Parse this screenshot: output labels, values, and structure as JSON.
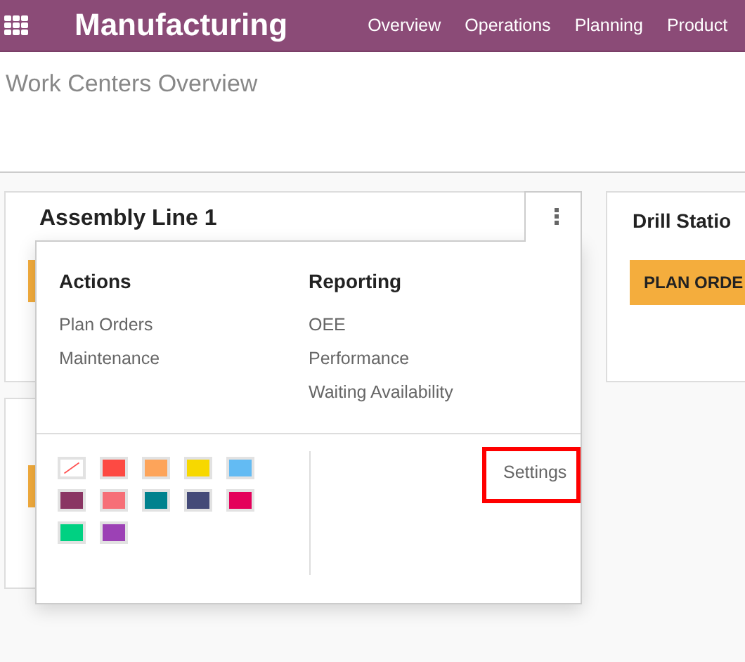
{
  "navbar": {
    "app_title": "Manufacturing",
    "menu": [
      {
        "label": "Overview"
      },
      {
        "label": "Operations"
      },
      {
        "label": "Planning"
      },
      {
        "label": "Product"
      }
    ]
  },
  "control_panel": {
    "title": "Work Centers Overview"
  },
  "cards": [
    {
      "title": "Assembly Line 1",
      "dropdown_open": true
    },
    {
      "title": "Drill Statio",
      "button": "PLAN ORDE",
      "dropdown_open": false
    }
  ],
  "dropdown": {
    "sections": [
      {
        "heading": "Actions",
        "items": [
          "Plan Orders",
          "Maintenance"
        ]
      },
      {
        "heading": "Reporting",
        "items": [
          "OEE",
          "Performance",
          "Waiting Availability"
        ]
      }
    ],
    "colors": [
      {
        "kind": "none",
        "color": "#ffffff"
      },
      {
        "kind": "swatch",
        "color": "#fd4a43"
      },
      {
        "kind": "swatch",
        "color": "#fda45a"
      },
      {
        "kind": "swatch",
        "color": "#f7d800"
      },
      {
        "kind": "swatch",
        "color": "#63bbf3"
      },
      {
        "kind": "swatch",
        "color": "#8a3563"
      },
      {
        "kind": "swatch",
        "color": "#f66f77"
      },
      {
        "kind": "swatch",
        "color": "#00828e"
      },
      {
        "kind": "swatch",
        "color": "#444a78"
      },
      {
        "kind": "swatch",
        "color": "#e4005a"
      },
      {
        "kind": "swatch",
        "color": "#00d182"
      },
      {
        "kind": "swatch",
        "color": "#9c41b5"
      }
    ],
    "settings": {
      "label": "Settings",
      "highlighted": true
    }
  }
}
